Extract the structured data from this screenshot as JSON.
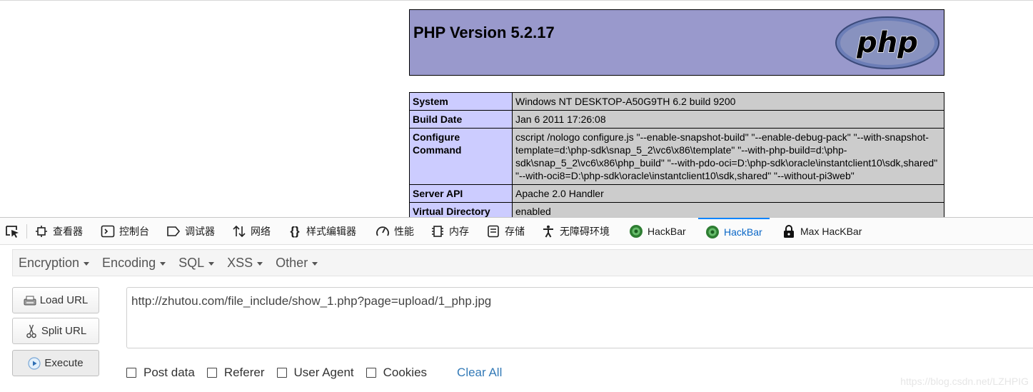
{
  "php_header": {
    "title": "PHP Version 5.2.17",
    "logo_text": "php"
  },
  "info_rows": [
    {
      "key": "System",
      "value": "Windows NT DESKTOP-A50G9TH 6.2 build 9200"
    },
    {
      "key": "Build Date",
      "value": "Jan 6 2011 17:26:08"
    },
    {
      "key": "Configure Command",
      "value": "cscript /nologo configure.js \"--enable-snapshot-build\" \"--enable-debug-pack\" \"--with-snapshot-template=d:\\php-sdk\\snap_5_2\\vc6\\x86\\template\" \"--with-php-build=d:\\php-sdk\\snap_5_2\\vc6\\x86\\php_build\" \"--with-pdo-oci=D:\\php-sdk\\oracle\\instantclient10\\sdk,shared\" \"--with-oci8=D:\\php-sdk\\oracle\\instantclient10\\sdk,shared\" \"--without-pi3web\""
    },
    {
      "key": "Server API",
      "value": "Apache 2.0 Handler"
    },
    {
      "key": "Virtual Directory",
      "value": "enabled"
    }
  ],
  "devtools": {
    "tabs": [
      {
        "label": "查看器",
        "icon": "inspector-icon"
      },
      {
        "label": "控制台",
        "icon": "console-icon"
      },
      {
        "label": "调试器",
        "icon": "debugger-icon"
      },
      {
        "label": "网络",
        "icon": "network-icon"
      },
      {
        "label": "样式编辑器",
        "icon": "style-editor-icon"
      },
      {
        "label": "性能",
        "icon": "performance-icon"
      },
      {
        "label": "内存",
        "icon": "memory-icon"
      },
      {
        "label": "存储",
        "icon": "storage-icon"
      },
      {
        "label": "无障碍环境",
        "icon": "accessibility-icon"
      },
      {
        "label": "HackBar",
        "icon": "hackbar-icon"
      },
      {
        "label": "HackBar",
        "icon": "hackbar-icon",
        "active": true
      },
      {
        "label": "Max HacKBar",
        "icon": "max-hackbar-icon"
      }
    ]
  },
  "hackbar": {
    "menu": [
      "Encryption",
      "Encoding",
      "SQL",
      "XSS",
      "Other"
    ],
    "buttons": {
      "load": "Load URL",
      "split": "Split URL",
      "execute": "Execute"
    },
    "url": "http://zhutou.com/file_include/show_1.php?page=upload/1_php.jpg",
    "options": [
      "Post data",
      "Referer",
      "User Agent",
      "Cookies"
    ],
    "clear_all": "Clear All"
  },
  "watermark": "https://blog.csdn.net/LZHPIG",
  "colors": {
    "php_header": "#9999cc",
    "key_cell": "#ccccff",
    "value_cell": "#cccccc",
    "active_tab": "#0a67c7",
    "link": "#337ab7"
  }
}
